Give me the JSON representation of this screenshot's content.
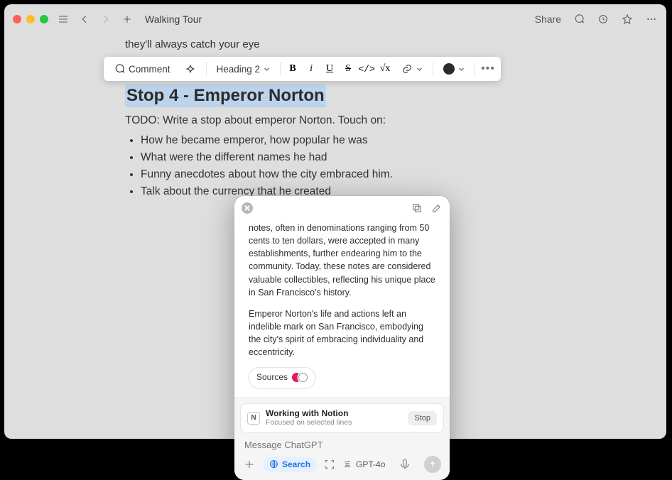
{
  "window": {
    "title": "Walking Tour",
    "share_label": "Share"
  },
  "doc": {
    "prev_line": "they'll always catch your eye",
    "heading": "Stop 4 - Emperor Norton",
    "todo_intro": "TODO: Write a stop about emperor Norton. Touch on:",
    "bullets": [
      "How he became emperor, how popular he was",
      "What were the different names he had",
      "Funny anecdotes about how the city embraced him.",
      "Talk about the currency that he created"
    ]
  },
  "toolbar": {
    "comment": "Comment",
    "heading_dropdown": "Heading 2",
    "bold": "B",
    "italic": "i",
    "underline": "U",
    "strike": "S",
    "code": "</>",
    "equation": "√x"
  },
  "overlay": {
    "para1": "notes, often in denominations ranging from 50 cents to ten dollars, were accepted in many establishments, further endearing him to the community. Today, these notes are considered valuable collectibles, reflecting his unique place in San Francisco's history.",
    "para2": "Emperor Norton's life and actions left an indelible mark on San Francisco, embodying the city's spirit of embracing individuality and eccentricity.",
    "sources_label": "Sources",
    "context_title": "Working with Notion",
    "context_sub": "Focused on selected lines",
    "stop": "Stop",
    "input_placeholder": "Message ChatGPT",
    "search_label": "Search",
    "model_label": "GPT-4o"
  }
}
